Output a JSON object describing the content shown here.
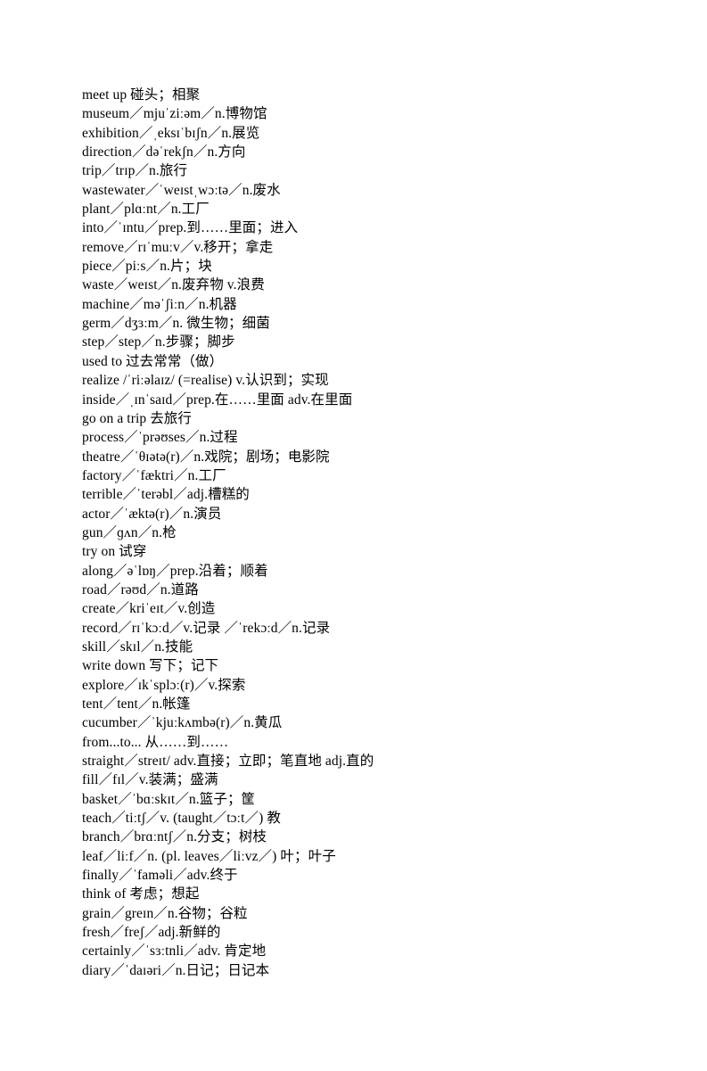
{
  "document": {
    "type": "vocabulary-word-list",
    "page_background": "#ffffff",
    "text_color": "#000000",
    "entries": [
      {
        "text": "meet up  碰头；相聚"
      },
      {
        "text": "museum／mjuˈziːəm／n.博物馆"
      },
      {
        "text": "exhibition／ˌeksɪˈbɪʃn／n.展览"
      },
      {
        "text": "direction／dəˈrekʃn／n.方向"
      },
      {
        "text": "trip／trɪp／n.旅行"
      },
      {
        "text": "wastewater／ˈweɪstˌwɔːtə／n.废水"
      },
      {
        "text": "plant／plɑːnt／n.工厂"
      },
      {
        "text": "into／ˈɪntu／prep.到……里面；进入"
      },
      {
        "text": "remove／rɪˈmuːv／v.移开；拿走"
      },
      {
        "text": "piece／piːs／n.片；块"
      },
      {
        "text": "waste／weɪst／n.废弃物 v.浪费"
      },
      {
        "text": "machine／məˈʃiːn／n.机器"
      },
      {
        "text": "germ／dʒɜːm／n. 微生物；细菌"
      },
      {
        "text": "step／step／n.步骤；脚步"
      },
      {
        "text": "used to 过去常常（做）"
      },
      {
        "text": "realize /ˈriːəlaɪz/ (=realise)   v.认识到；实现"
      },
      {
        "text": "inside／ˌɪnˈsaɪd／prep.在……里面 adv.在里面"
      },
      {
        "text": "go on a trip  去旅行"
      },
      {
        "text": "process／ˈprəʊses／n.过程"
      },
      {
        "text": "theatre／ˈθɪətə(r)／n.戏院；剧场；电影院"
      },
      {
        "text": "factory／ˈfæktri／n.工厂"
      },
      {
        "text": "terrible／ˈterəbl／adj.槽糕的"
      },
      {
        "text": "actor／ˈæktə(r)／n.演员"
      },
      {
        "text": "gun／ɡʌn／n.枪"
      },
      {
        "text": "try on  试穿"
      },
      {
        "text": "along／əˈlɒŋ／prep.沿着；顺着"
      },
      {
        "text": "road／rəʊd／n.道路"
      },
      {
        "text": "create／kriˈeɪt／v.创造"
      },
      {
        "text": "record／rɪˈkɔːd／v.记录 ／ˈrekɔːd／n.记录"
      },
      {
        "text": "skill／skɪl／n.技能"
      },
      {
        "text": "write down 写下；记下"
      },
      {
        "text": "explore／ɪkˈsplɔː(r)／v.探索"
      },
      {
        "text": "tent／tent／n.帐篷"
      },
      {
        "text": "cucumber／ˈkjuːkʌmbə(r)／n.黄瓜"
      },
      {
        "text": "from...to...  从……到……"
      },
      {
        "text": "straight／streɪt/   adv.直接；立即；笔直地 adj.直的"
      },
      {
        "text": "fill／fɪl／v.装满；盛满"
      },
      {
        "text": "basket／ˈbɑːskɪt／n.篮子；筐"
      },
      {
        "text": "teach／tiːtʃ／v. (taught／tɔːt／) 教"
      },
      {
        "text": "branch／brɑːntʃ／n.分支；树枝"
      },
      {
        "text": "leaf／liːf／n.  (pl.  leaves／liːvz／) 叶；叶子"
      },
      {
        "text": "finally／ˈfamǝli／adv.终于"
      },
      {
        "text": "think of  考虑；想起"
      },
      {
        "text": "grain／greɪn／n.谷物；谷粒"
      },
      {
        "text": "fresh／freʃ／adj.新鲜的"
      },
      {
        "text": "certainly／ˈsɜːtnli／adv. 肯定地"
      },
      {
        "text": "diary／ˈdaɪəri／n.日记；日记本"
      }
    ]
  }
}
